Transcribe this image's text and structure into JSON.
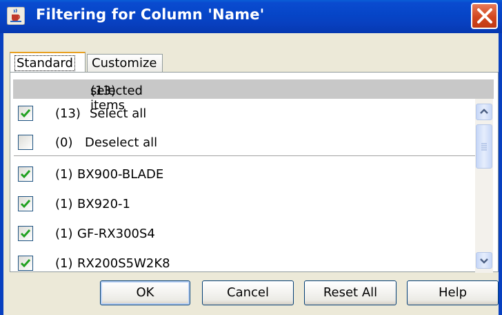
{
  "dialog": {
    "title": "Filtering for Column 'Name'"
  },
  "tabs": [
    {
      "label": "Standard",
      "active": true
    },
    {
      "label": "Customize",
      "active": false
    }
  ],
  "summary": {
    "count": "(13)",
    "text": "selected items"
  },
  "actions": [
    {
      "count": "(13)",
      "label": "Select all",
      "checked": true
    },
    {
      "count": "(0)",
      "label": "Deselect all",
      "checked": false
    }
  ],
  "items": [
    {
      "count": "(1)",
      "label": "BX900-BLADE",
      "checked": true
    },
    {
      "count": "(1)",
      "label": "BX920-1",
      "checked": true
    },
    {
      "count": "(1)",
      "label": "GF-RX300S4",
      "checked": true
    },
    {
      "count": "(1)",
      "label": "RX200S5W2K8",
      "checked": true
    }
  ],
  "buttons": {
    "ok": "OK",
    "cancel": "Cancel",
    "reset_all": "Reset All",
    "help": "Help"
  },
  "colors": {
    "titlebar": "#0645c7",
    "check": "#21a121",
    "header_bar": "#c8c8c8"
  },
  "icons": {
    "window": "java-cup-icon",
    "close": "close-icon",
    "check": "check-icon",
    "scroll_up": "chevron-up-icon",
    "scroll_down": "chevron-down-icon"
  }
}
